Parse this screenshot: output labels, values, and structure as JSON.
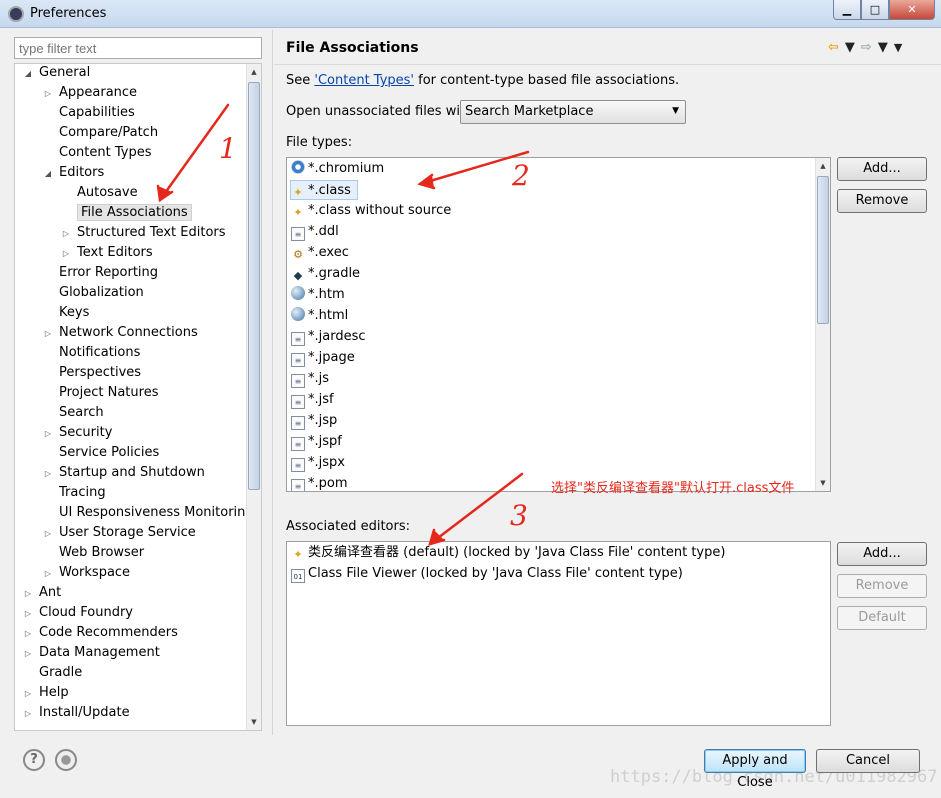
{
  "window": {
    "title": "Preferences",
    "controls": {
      "minimize": "▁",
      "maximize": "□",
      "close": "✕"
    }
  },
  "filter": {
    "placeholder": "type filter text"
  },
  "tree": {
    "items": [
      {
        "label": "General",
        "expand": "◢",
        "level": 0
      },
      {
        "label": "Appearance",
        "expand": "▷",
        "level": 1
      },
      {
        "label": "Capabilities",
        "expand": "",
        "level": 1
      },
      {
        "label": "Compare/Patch",
        "expand": "",
        "level": 1
      },
      {
        "label": "Content Types",
        "expand": "",
        "level": 1
      },
      {
        "label": "Editors",
        "expand": "◢",
        "level": 1
      },
      {
        "label": "Autosave",
        "expand": "",
        "level": 2
      },
      {
        "label": "File Associations",
        "expand": "",
        "level": 2,
        "selected": true
      },
      {
        "label": "Structured Text Editors",
        "expand": "▷",
        "level": 2
      },
      {
        "label": "Text Editors",
        "expand": "▷",
        "level": 2
      },
      {
        "label": "Error Reporting",
        "expand": "",
        "level": 1
      },
      {
        "label": "Globalization",
        "expand": "",
        "level": 1
      },
      {
        "label": "Keys",
        "expand": "",
        "level": 1
      },
      {
        "label": "Network Connections",
        "expand": "▷",
        "level": 1
      },
      {
        "label": "Notifications",
        "expand": "",
        "level": 1
      },
      {
        "label": "Perspectives",
        "expand": "",
        "level": 1
      },
      {
        "label": "Project Natures",
        "expand": "",
        "level": 1
      },
      {
        "label": "Search",
        "expand": "",
        "level": 1
      },
      {
        "label": "Security",
        "expand": "▷",
        "level": 1
      },
      {
        "label": "Service Policies",
        "expand": "",
        "level": 1
      },
      {
        "label": "Startup and Shutdown",
        "expand": "▷",
        "level": 1
      },
      {
        "label": "Tracing",
        "expand": "",
        "level": 1
      },
      {
        "label": "UI Responsiveness Monitoring",
        "expand": "",
        "level": 1
      },
      {
        "label": "User Storage Service",
        "expand": "▷",
        "level": 1
      },
      {
        "label": "Web Browser",
        "expand": "",
        "level": 1
      },
      {
        "label": "Workspace",
        "expand": "▷",
        "level": 1
      },
      {
        "label": "Ant",
        "expand": "▷",
        "level": 0
      },
      {
        "label": "Cloud Foundry",
        "expand": "▷",
        "level": 0
      },
      {
        "label": "Code Recommenders",
        "expand": "▷",
        "level": 0
      },
      {
        "label": "Data Management",
        "expand": "▷",
        "level": 0
      },
      {
        "label": "Gradle",
        "expand": "",
        "level": 0
      },
      {
        "label": "Help",
        "expand": "▷",
        "level": 0
      },
      {
        "label": "Install/Update",
        "expand": "▷",
        "level": 0
      }
    ]
  },
  "page": {
    "title": "File Associations",
    "see_prefix": "See ",
    "see_link": "'Content Types'",
    "see_suffix": " for content-type based file associations.",
    "open_label": "Open unassociated files with:",
    "open_value": "Search Marketplace",
    "file_types_label": "File types:",
    "file_types": [
      {
        "name": "*.chromium",
        "icon": "chrome"
      },
      {
        "name": "*.class",
        "icon": "class",
        "selected": true
      },
      {
        "name": "*.class without source",
        "icon": "class"
      },
      {
        "name": "*.ddl",
        "icon": "doc"
      },
      {
        "name": "*.exec",
        "icon": "gear"
      },
      {
        "name": "*.gradle",
        "icon": "gradle"
      },
      {
        "name": "*.htm",
        "icon": "globe"
      },
      {
        "name": "*.html",
        "icon": "globe"
      },
      {
        "name": "*.jardesc",
        "icon": "doc"
      },
      {
        "name": "*.jpage",
        "icon": "doc"
      },
      {
        "name": "*.js",
        "icon": "doc"
      },
      {
        "name": "*.jsf",
        "icon": "doc"
      },
      {
        "name": "*.jsp",
        "icon": "doc"
      },
      {
        "name": "*.jspf",
        "icon": "doc"
      },
      {
        "name": "*.jspx",
        "icon": "doc"
      },
      {
        "name": "*.pom",
        "icon": "doc"
      }
    ],
    "file_type_buttons": {
      "add": "Add...",
      "remove": "Remove"
    },
    "editors_label": "Associated editors:",
    "editors": [
      {
        "name": "类反编译查看器 (default) (locked by 'Java Class File' content type)",
        "icon": "class"
      },
      {
        "name": "Class File Viewer (locked by 'Java Class File' content type)",
        "icon": "bin"
      }
    ],
    "editor_buttons": {
      "add": "Add...",
      "remove": "Remove",
      "default": "Default"
    }
  },
  "annotation": {
    "note": "选择\"类反编译查看器\"默认打开.class文件",
    "marks": [
      "1",
      "2",
      "3"
    ],
    "color": "#e4281c"
  },
  "footer": {
    "apply_close": "Apply and Close",
    "cancel": "Cancel",
    "watermark": "https://blog.csdn.net/u011982967"
  }
}
